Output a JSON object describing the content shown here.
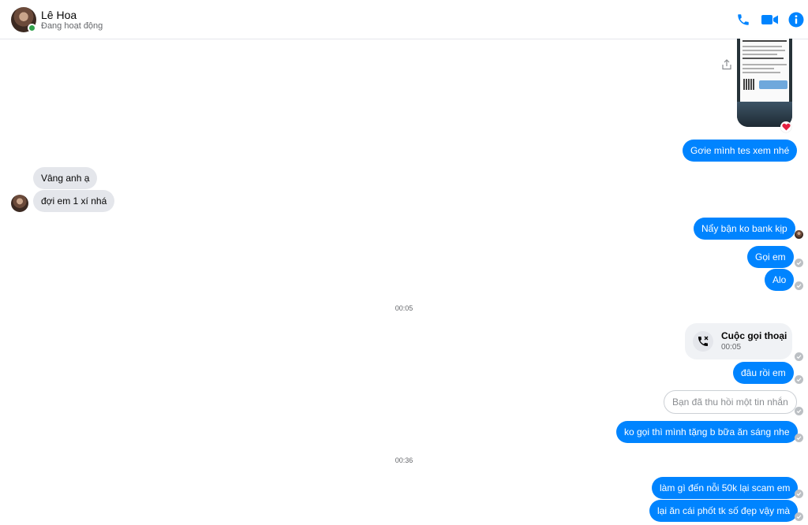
{
  "header": {
    "contact_name": "Lê Hoa",
    "status": "Đang hoạt động"
  },
  "colors": {
    "accent": "#0084ff",
    "online": "#31a24c",
    "incoming_bubble": "#e4e6eb",
    "heart": "#e41e3f"
  },
  "icons": {
    "phone": "phone-icon",
    "video": "video-camera-icon",
    "info": "info-icon",
    "share": "share-icon",
    "heart": "heart-icon",
    "seen": "check-icon",
    "missed_call": "missed-call-icon"
  },
  "messages": {
    "m1": "Gơie mình tes xem nhé",
    "m2": "Vâng anh ạ",
    "m3": "đợi em  1 xí nhá",
    "m4": "Nẩy bận ko bank kịp",
    "m5": "Gọi em",
    "m6": "Alo",
    "ts1": "00:05",
    "call_title": "Cuộc gọi thoại",
    "call_duration": "00:05",
    "m7": "đâu rồi em",
    "m8": "Bạn đã thu hồi một tin nhắn",
    "m9": "ko gọi thì mình tặng b bữa ăn sáng nhe",
    "ts2": "00:36",
    "m10": "làm gì đến nỗi 50k lại scam em",
    "m11": "lại ăn cái phốt tk số đẹp vậy mà"
  }
}
